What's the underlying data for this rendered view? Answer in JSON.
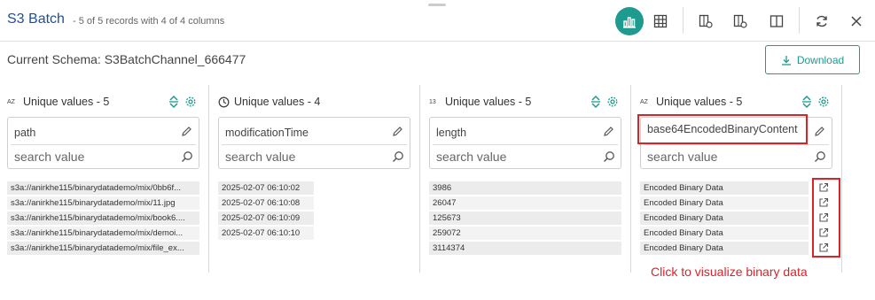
{
  "header": {
    "title": "S3 Batch",
    "subtitle": "- 5 of 5 records with 4 of 4 columns"
  },
  "toolbar": {
    "items": [
      "chart-view-icon",
      "table-view-icon",
      "filter-add-icon",
      "filter-remove-icon",
      "column-panel-icon",
      "refresh-icon",
      "close-icon"
    ],
    "accent_color": "#1f9a8e"
  },
  "schema": {
    "text": "Current Schema: S3BatchChannel_666477"
  },
  "download": {
    "label": "Download"
  },
  "columns": [
    {
      "type_icon": "AZ",
      "unique_label": "Unique values - 5",
      "field": "path",
      "search_placeholder": "search value",
      "values": [
        "s3a://anirkhe115/binarydatademo/mix/0bb6f...",
        "s3a://anirkhe115/binarydatademo/mix/11.jpg",
        "s3a://anirkhe115/binarydatademo/mix/book6....",
        "s3a://anirkhe115/binarydatademo/mix/demoi...",
        "s3a://anirkhe115/binarydatademo/mix/file_ex..."
      ]
    },
    {
      "type_icon": "clock",
      "unique_label": "Unique values - 4",
      "field": "modificationTime",
      "search_placeholder": "search value",
      "values": [
        "2025-02-07 06:10:02",
        "2025-02-07 06:10:08",
        "2025-02-07 06:10:09",
        "2025-02-07 06:10:10"
      ]
    },
    {
      "type_icon": "13",
      "unique_label": "Unique values - 5",
      "field": "length",
      "search_placeholder": "search value",
      "values": [
        "3986",
        "26047",
        "125673",
        "259072",
        "3114374"
      ]
    },
    {
      "type_icon": "AZ",
      "unique_label": "Unique values - 5",
      "field": "base64EncodedBinaryContent",
      "search_placeholder": "search value",
      "values": [
        "Encoded Binary Data",
        "Encoded Binary Data",
        "Encoded Binary Data",
        "Encoded Binary Data",
        "Encoded Binary Data"
      ]
    }
  ],
  "hint": {
    "text": "Click to visualize binary data",
    "color": "#d9232a"
  }
}
